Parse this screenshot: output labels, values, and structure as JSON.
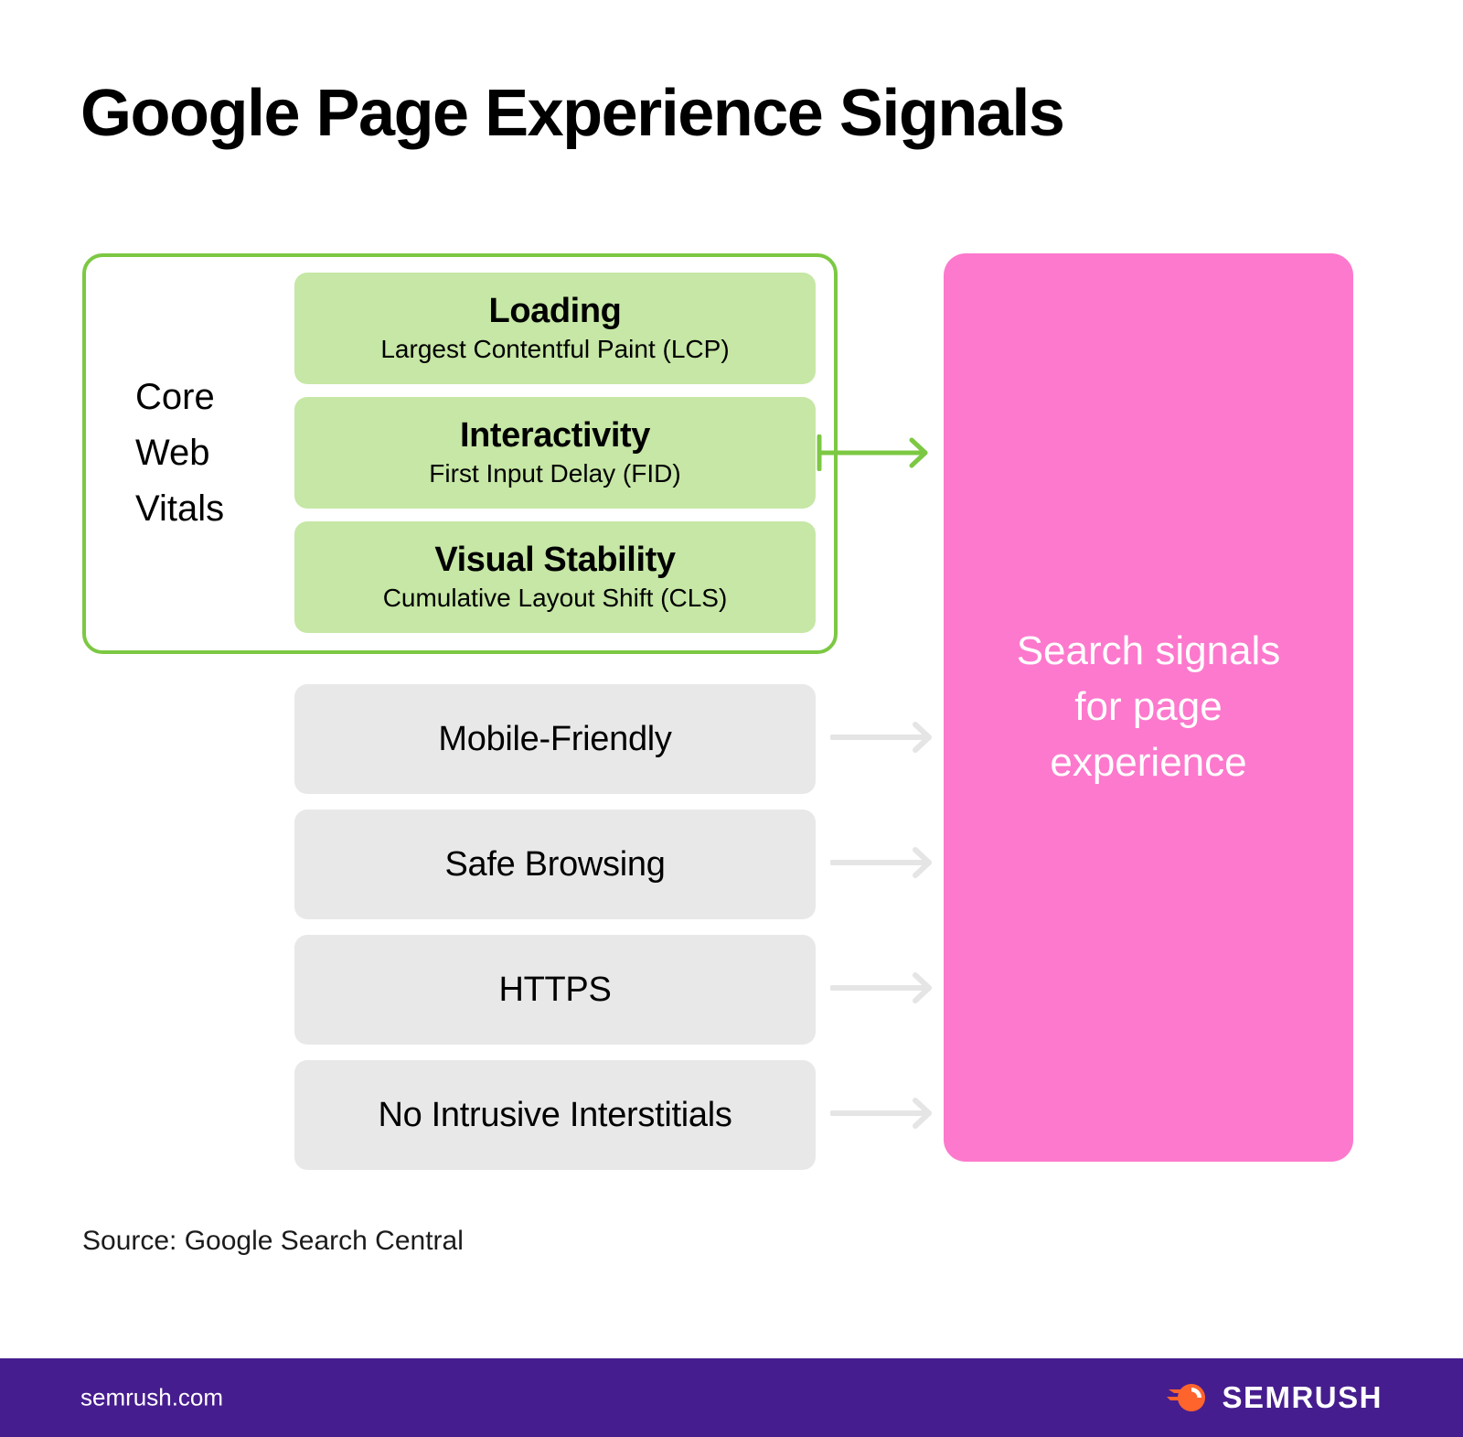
{
  "page": {
    "title": "Google Page Experience Signals",
    "source_note": "Source: Google Search Central",
    "background_color": "#FFFFFF"
  },
  "core_web_vitals": {
    "group_label_lines": [
      "Core",
      "Web",
      "Vitals"
    ],
    "border_color": "#7CC843",
    "card_color": "#C6E7A5",
    "metrics": [
      {
        "title": "Loading",
        "subtitle": "Largest Contentful Paint (LCP)"
      },
      {
        "title": "Interactivity",
        "subtitle": "First Input Delay (FID)"
      },
      {
        "title": "Visual Stability",
        "subtitle": "Cumulative Layout Shift (CLS)"
      }
    ]
  },
  "other_signals": {
    "card_color": "#E8E8E8",
    "arrow_color": "#E5E5E5",
    "items": [
      {
        "label": "Mobile-Friendly"
      },
      {
        "label": "Safe Browsing"
      },
      {
        "label": "HTTPS"
      },
      {
        "label": "No Intrusive Interstitials"
      }
    ]
  },
  "outcome": {
    "text_lines": [
      "Search signals",
      "for page",
      "experience"
    ],
    "panel_color": "#FD79CD",
    "text_color": "#FFFFFF"
  },
  "footer": {
    "background_color": "#461D8E",
    "url": "semrush.com",
    "brand": "SEMRUSH",
    "logo_color": "#FF642D"
  }
}
